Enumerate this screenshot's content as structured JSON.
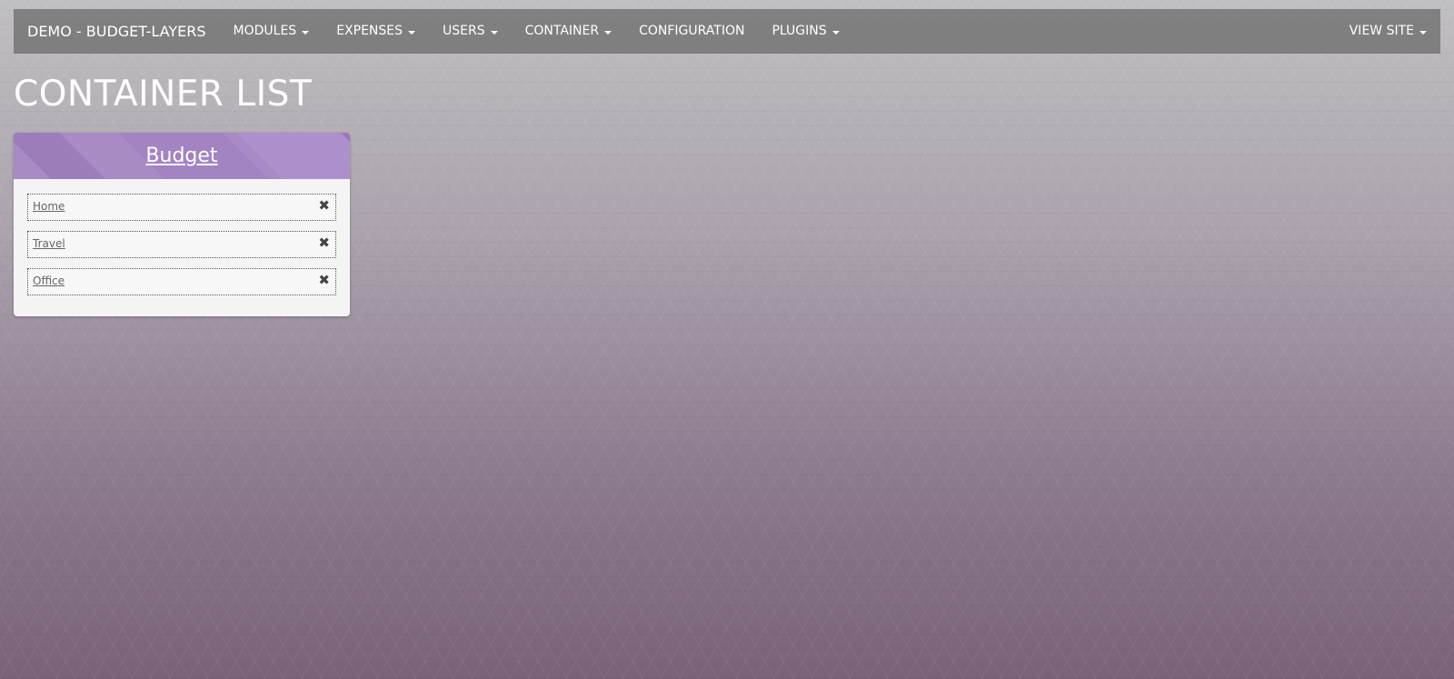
{
  "navbar": {
    "brand": "DEMO - BUDGET-LAYERS",
    "items": [
      {
        "label": "MODULES",
        "dropdown": true
      },
      {
        "label": "EXPENSES",
        "dropdown": true
      },
      {
        "label": "USERS",
        "dropdown": true
      },
      {
        "label": "CONTAINER",
        "dropdown": true
      },
      {
        "label": "CONFIGURATION",
        "dropdown": false
      },
      {
        "label": "PLUGINS",
        "dropdown": true
      }
    ],
    "right_item": {
      "label": "VIEW SITE",
      "dropdown": true
    }
  },
  "page": {
    "title": "CONTAINER LIST"
  },
  "panel": {
    "title": "Budget",
    "header_color": "#a88ac5",
    "items": [
      {
        "label": "Home",
        "remove_icon": "✖"
      },
      {
        "label": "Travel",
        "remove_icon": "✖"
      },
      {
        "label": "Office",
        "remove_icon": "✖"
      }
    ]
  }
}
